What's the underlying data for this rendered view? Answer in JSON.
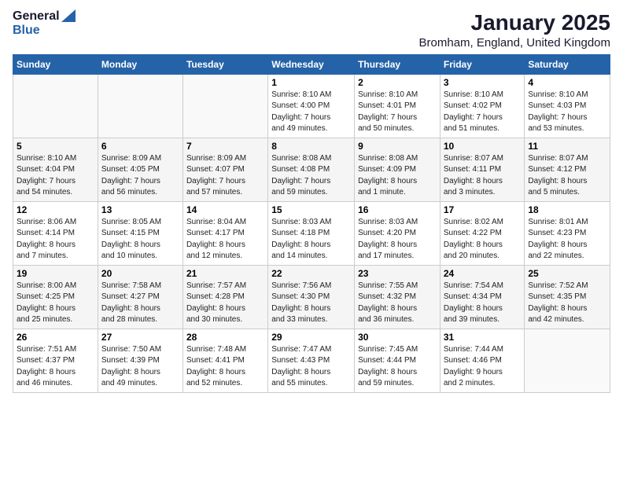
{
  "logo": {
    "general": "General",
    "blue": "Blue"
  },
  "title": "January 2025",
  "subtitle": "Bromham, England, United Kingdom",
  "weekdays": [
    "Sunday",
    "Monday",
    "Tuesday",
    "Wednesday",
    "Thursday",
    "Friday",
    "Saturday"
  ],
  "weeks": [
    [
      {
        "day": "",
        "info": ""
      },
      {
        "day": "",
        "info": ""
      },
      {
        "day": "",
        "info": ""
      },
      {
        "day": "1",
        "info": "Sunrise: 8:10 AM\nSunset: 4:00 PM\nDaylight: 7 hours\nand 49 minutes."
      },
      {
        "day": "2",
        "info": "Sunrise: 8:10 AM\nSunset: 4:01 PM\nDaylight: 7 hours\nand 50 minutes."
      },
      {
        "day": "3",
        "info": "Sunrise: 8:10 AM\nSunset: 4:02 PM\nDaylight: 7 hours\nand 51 minutes."
      },
      {
        "day": "4",
        "info": "Sunrise: 8:10 AM\nSunset: 4:03 PM\nDaylight: 7 hours\nand 53 minutes."
      }
    ],
    [
      {
        "day": "5",
        "info": "Sunrise: 8:10 AM\nSunset: 4:04 PM\nDaylight: 7 hours\nand 54 minutes."
      },
      {
        "day": "6",
        "info": "Sunrise: 8:09 AM\nSunset: 4:05 PM\nDaylight: 7 hours\nand 56 minutes."
      },
      {
        "day": "7",
        "info": "Sunrise: 8:09 AM\nSunset: 4:07 PM\nDaylight: 7 hours\nand 57 minutes."
      },
      {
        "day": "8",
        "info": "Sunrise: 8:08 AM\nSunset: 4:08 PM\nDaylight: 7 hours\nand 59 minutes."
      },
      {
        "day": "9",
        "info": "Sunrise: 8:08 AM\nSunset: 4:09 PM\nDaylight: 8 hours\nand 1 minute."
      },
      {
        "day": "10",
        "info": "Sunrise: 8:07 AM\nSunset: 4:11 PM\nDaylight: 8 hours\nand 3 minutes."
      },
      {
        "day": "11",
        "info": "Sunrise: 8:07 AM\nSunset: 4:12 PM\nDaylight: 8 hours\nand 5 minutes."
      }
    ],
    [
      {
        "day": "12",
        "info": "Sunrise: 8:06 AM\nSunset: 4:14 PM\nDaylight: 8 hours\nand 7 minutes."
      },
      {
        "day": "13",
        "info": "Sunrise: 8:05 AM\nSunset: 4:15 PM\nDaylight: 8 hours\nand 10 minutes."
      },
      {
        "day": "14",
        "info": "Sunrise: 8:04 AM\nSunset: 4:17 PM\nDaylight: 8 hours\nand 12 minutes."
      },
      {
        "day": "15",
        "info": "Sunrise: 8:03 AM\nSunset: 4:18 PM\nDaylight: 8 hours\nand 14 minutes."
      },
      {
        "day": "16",
        "info": "Sunrise: 8:03 AM\nSunset: 4:20 PM\nDaylight: 8 hours\nand 17 minutes."
      },
      {
        "day": "17",
        "info": "Sunrise: 8:02 AM\nSunset: 4:22 PM\nDaylight: 8 hours\nand 20 minutes."
      },
      {
        "day": "18",
        "info": "Sunrise: 8:01 AM\nSunset: 4:23 PM\nDaylight: 8 hours\nand 22 minutes."
      }
    ],
    [
      {
        "day": "19",
        "info": "Sunrise: 8:00 AM\nSunset: 4:25 PM\nDaylight: 8 hours\nand 25 minutes."
      },
      {
        "day": "20",
        "info": "Sunrise: 7:58 AM\nSunset: 4:27 PM\nDaylight: 8 hours\nand 28 minutes."
      },
      {
        "day": "21",
        "info": "Sunrise: 7:57 AM\nSunset: 4:28 PM\nDaylight: 8 hours\nand 30 minutes."
      },
      {
        "day": "22",
        "info": "Sunrise: 7:56 AM\nSunset: 4:30 PM\nDaylight: 8 hours\nand 33 minutes."
      },
      {
        "day": "23",
        "info": "Sunrise: 7:55 AM\nSunset: 4:32 PM\nDaylight: 8 hours\nand 36 minutes."
      },
      {
        "day": "24",
        "info": "Sunrise: 7:54 AM\nSunset: 4:34 PM\nDaylight: 8 hours\nand 39 minutes."
      },
      {
        "day": "25",
        "info": "Sunrise: 7:52 AM\nSunset: 4:35 PM\nDaylight: 8 hours\nand 42 minutes."
      }
    ],
    [
      {
        "day": "26",
        "info": "Sunrise: 7:51 AM\nSunset: 4:37 PM\nDaylight: 8 hours\nand 46 minutes."
      },
      {
        "day": "27",
        "info": "Sunrise: 7:50 AM\nSunset: 4:39 PM\nDaylight: 8 hours\nand 49 minutes."
      },
      {
        "day": "28",
        "info": "Sunrise: 7:48 AM\nSunset: 4:41 PM\nDaylight: 8 hours\nand 52 minutes."
      },
      {
        "day": "29",
        "info": "Sunrise: 7:47 AM\nSunset: 4:43 PM\nDaylight: 8 hours\nand 55 minutes."
      },
      {
        "day": "30",
        "info": "Sunrise: 7:45 AM\nSunset: 4:44 PM\nDaylight: 8 hours\nand 59 minutes."
      },
      {
        "day": "31",
        "info": "Sunrise: 7:44 AM\nSunset: 4:46 PM\nDaylight: 9 hours\nand 2 minutes."
      },
      {
        "day": "",
        "info": ""
      }
    ]
  ]
}
